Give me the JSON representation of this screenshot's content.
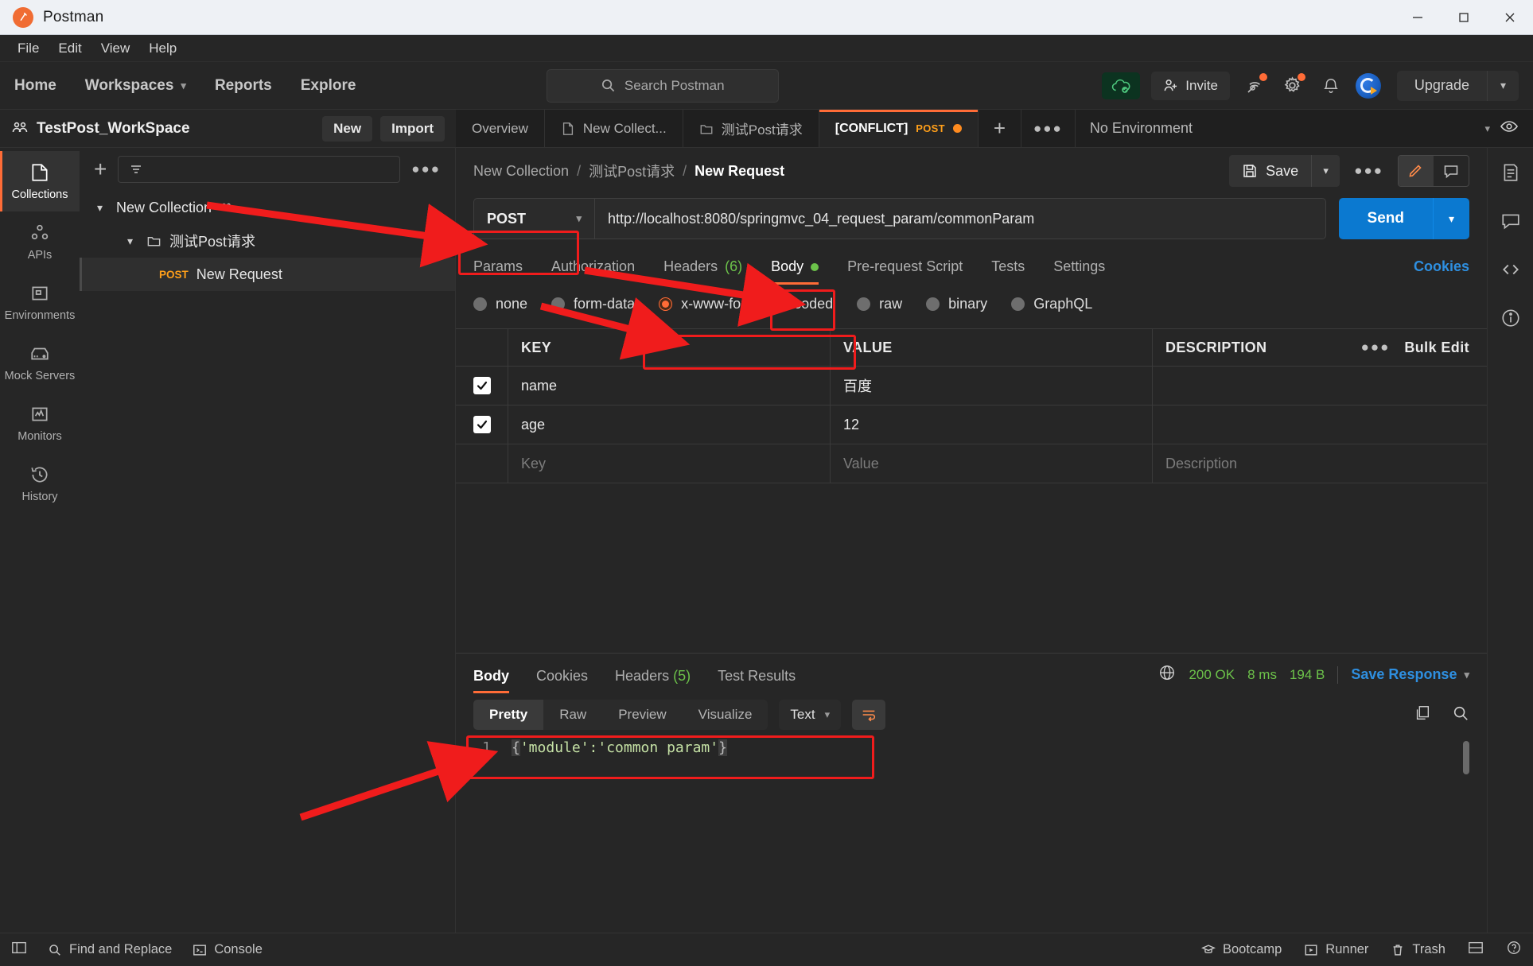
{
  "window": {
    "title": "Postman",
    "minimize": "–",
    "maximize": "□",
    "close": "✕"
  },
  "menu": [
    "File",
    "Edit",
    "View",
    "Help"
  ],
  "topnav": {
    "links": [
      "Home",
      "Workspaces",
      "Reports",
      "Explore"
    ],
    "search_placeholder": "Search Postman",
    "invite_label": "Invite",
    "upgrade_label": "Upgrade"
  },
  "workspace": {
    "name": "TestPost_WorkSpace",
    "new_label": "New",
    "import_label": "Import"
  },
  "tabs": [
    {
      "label": "Overview",
      "icon": "",
      "active": false
    },
    {
      "label": "New Collect...",
      "icon": "collection-icon",
      "active": false
    },
    {
      "label": "测试Post请求",
      "icon": "folder-icon",
      "active": false
    },
    {
      "label": "[CONFLICT]",
      "method": "POST",
      "active": true
    }
  ],
  "environment": {
    "selected": "No Environment"
  },
  "rail": [
    {
      "label": "Collections",
      "icon": "collections-icon",
      "active": true
    },
    {
      "label": "APIs",
      "icon": "apis-icon",
      "active": false
    },
    {
      "label": "Environments",
      "icon": "environments-icon",
      "active": false
    },
    {
      "label": "Mock Servers",
      "icon": "mock-servers-icon",
      "active": false
    },
    {
      "label": "Monitors",
      "icon": "monitors-icon",
      "active": false
    },
    {
      "label": "History",
      "icon": "history-icon",
      "active": false
    }
  ],
  "sidebar": {
    "filter_placeholder": "",
    "tree": [
      {
        "label": "New Collection",
        "level": 1,
        "caret": "⌄",
        "icon": "shared-icon",
        "selected": false
      },
      {
        "label": "测试Post请求",
        "level": 2,
        "caret": "⌄",
        "icon": "folder-icon",
        "selected": false
      },
      {
        "label": "New Request",
        "level": 3,
        "method": "POST",
        "selected": true
      }
    ]
  },
  "request": {
    "breadcrumb": [
      "New Collection",
      "测试Post请求",
      "New Request"
    ],
    "breadcrumb_sep": "/",
    "save_label": "Save",
    "method": "POST",
    "url": "http://localhost:8080/springmvc_04_request_param/commonParam",
    "send_label": "Send",
    "tabs": [
      {
        "label": "Params",
        "active": false
      },
      {
        "label": "Authorization",
        "active": false
      },
      {
        "label": "Headers",
        "count": "(6)",
        "active": false
      },
      {
        "label": "Body",
        "active": true,
        "dot": true
      },
      {
        "label": "Pre-request Script",
        "active": false
      },
      {
        "label": "Tests",
        "active": false
      },
      {
        "label": "Settings",
        "active": false
      }
    ],
    "cookies_link": "Cookies",
    "body_types": [
      {
        "label": "none",
        "selected": false
      },
      {
        "label": "form-data",
        "selected": false
      },
      {
        "label": "x-www-form-urlencoded",
        "selected": true
      },
      {
        "label": "raw",
        "selected": false
      },
      {
        "label": "binary",
        "selected": false
      },
      {
        "label": "GraphQL",
        "selected": false
      }
    ],
    "table": {
      "headers": [
        "KEY",
        "VALUE",
        "DESCRIPTION"
      ],
      "bulk_edit": "Bulk Edit",
      "rows": [
        {
          "checked": true,
          "key": "name",
          "value": "百度",
          "description": ""
        },
        {
          "checked": true,
          "key": "age",
          "value": "12",
          "description": ""
        }
      ],
      "empty_row": {
        "key": "Key",
        "value": "Value",
        "description": "Description"
      }
    }
  },
  "response": {
    "tabs": [
      {
        "label": "Body",
        "active": true
      },
      {
        "label": "Cookies",
        "active": false
      },
      {
        "label": "Headers",
        "count": "(5)",
        "active": false
      },
      {
        "label": "Test Results",
        "active": false
      }
    ],
    "status": "200 OK",
    "time": "8 ms",
    "size": "194 B",
    "save_response": "Save Response",
    "view_modes": [
      {
        "label": "Pretty",
        "active": true
      },
      {
        "label": "Raw",
        "active": false
      },
      {
        "label": "Preview",
        "active": false
      },
      {
        "label": "Visualize",
        "active": false
      }
    ],
    "format": "Text",
    "code": {
      "line_number": "1",
      "open_brace": "{",
      "content": "'module':'common param'",
      "close_brace": "}"
    }
  },
  "bottombar": {
    "left": [
      {
        "label": "Find and Replace",
        "icon": "search-icon"
      },
      {
        "label": "Console",
        "icon": "console-icon"
      }
    ],
    "right": [
      {
        "label": "Bootcamp",
        "icon": "bootcamp-icon"
      },
      {
        "label": "Runner",
        "icon": "runner-icon"
      },
      {
        "label": "Trash",
        "icon": "trash-icon"
      }
    ]
  },
  "colors": {
    "accent": "#ff6c37",
    "send_blue": "#0b79d0",
    "status_green": "#6cc24a",
    "annotation_red": "#f01c1c"
  }
}
